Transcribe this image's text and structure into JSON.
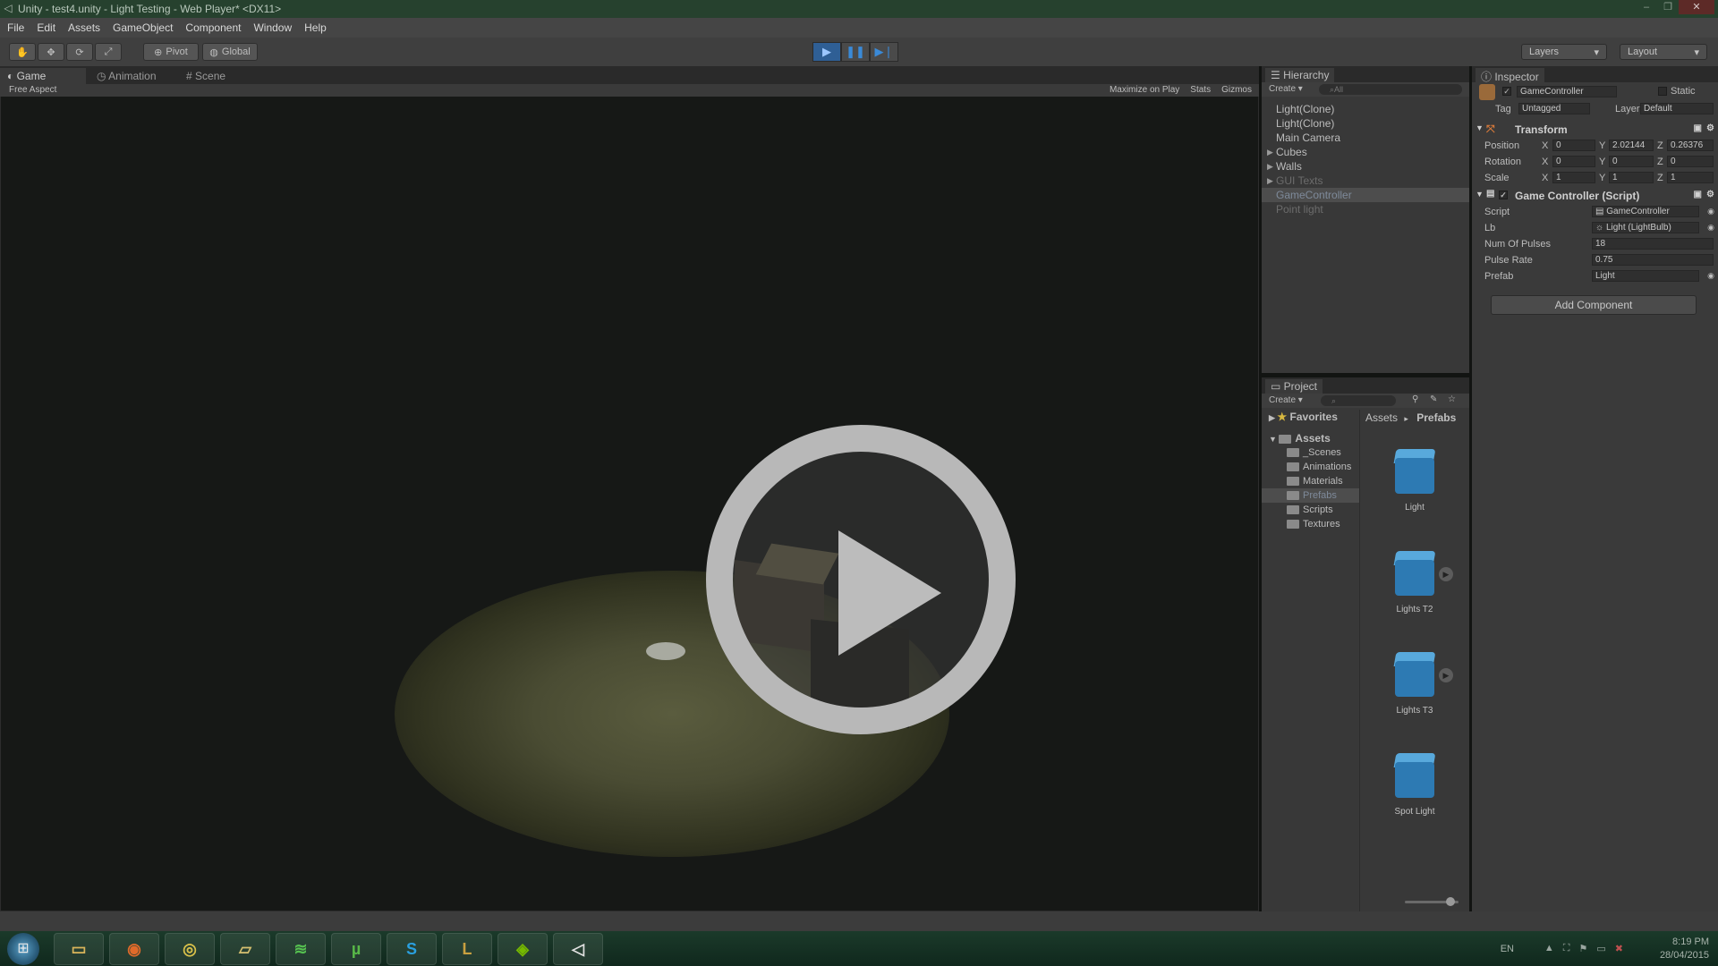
{
  "window": {
    "title": "Unity - test4.unity - Light Testing - Web Player* <DX11>",
    "controls": [
      "‒",
      "❐",
      "✕"
    ]
  },
  "menu": [
    "File",
    "Edit",
    "Assets",
    "GameObject",
    "Component",
    "Window",
    "Help"
  ],
  "toolbar": {
    "transform_tools": [
      "hand-icon",
      "move-icon",
      "rotate-icon",
      "scale-icon"
    ],
    "pivot_label": "Pivot",
    "global_label": "Global",
    "play_state": "playing",
    "layers_label": "Layers",
    "layout_label": "Layout"
  },
  "game_panel": {
    "tabs": [
      {
        "label": "Game",
        "active": true
      },
      {
        "label": "Animation",
        "active": false
      },
      {
        "label": "Scene",
        "active": false
      }
    ],
    "aspect": "Free Aspect",
    "options": [
      "Maximize on Play",
      "Stats",
      "Gizmos"
    ]
  },
  "hierarchy": {
    "title": "Hierarchy",
    "create_label": "Create",
    "search_placeholder": "All",
    "items": [
      {
        "label": "Light(Clone)",
        "expandable": false,
        "state": "normal"
      },
      {
        "label": "Light(Clone)",
        "expandable": false,
        "state": "normal"
      },
      {
        "label": "Main Camera",
        "expandable": false,
        "state": "normal"
      },
      {
        "label": "Cubes",
        "expandable": true,
        "state": "normal"
      },
      {
        "label": "Walls",
        "expandable": true,
        "state": "normal"
      },
      {
        "label": "GUI Texts",
        "expandable": true,
        "state": "dim"
      },
      {
        "label": "GameController",
        "expandable": false,
        "state": "selected"
      },
      {
        "label": "Point light",
        "expandable": false,
        "state": "dim"
      }
    ]
  },
  "project": {
    "title": "Project",
    "create_label": "Create",
    "favorites_label": "Favorites",
    "assets_label": "Assets",
    "folders": [
      {
        "label": "_Scenes",
        "selected": false
      },
      {
        "label": "Animations",
        "selected": false
      },
      {
        "label": "Materials",
        "selected": false
      },
      {
        "label": "Prefabs",
        "selected": true
      },
      {
        "label": "Scripts",
        "selected": false
      },
      {
        "label": "Textures",
        "selected": false
      }
    ],
    "breadcrumb": [
      "Assets",
      "Prefabs"
    ],
    "items": [
      {
        "label": "Light",
        "has_children": false
      },
      {
        "label": "Lights T2",
        "has_children": true
      },
      {
        "label": "Lights T3",
        "has_children": true
      },
      {
        "label": "Spot Light",
        "has_children": false
      }
    ]
  },
  "inspector": {
    "title": "Inspector",
    "object_name": "GameController",
    "static_label": "Static",
    "tag_label": "Tag",
    "tag_value": "Untagged",
    "layer_label": "Layer",
    "layer_value": "Default",
    "transform": {
      "title": "Transform",
      "rows": [
        {
          "label": "Position",
          "x": "0",
          "y": "2.02144",
          "z": "0.26376"
        },
        {
          "label": "Rotation",
          "x": "0",
          "y": "0",
          "z": "0"
        },
        {
          "label": "Scale",
          "x": "1",
          "y": "1",
          "z": "1"
        }
      ]
    },
    "script_component": {
      "title": "Game Controller (Script)",
      "fields": [
        {
          "label": "Script",
          "value": "GameController",
          "has_picker": true
        },
        {
          "label": "Lb",
          "value": "Light (LightBulb)",
          "has_picker": true
        },
        {
          "label": "Num Of Pulses",
          "value": "18",
          "has_picker": false
        },
        {
          "label": "Pulse Rate",
          "value": "0.75",
          "has_picker": false
        },
        {
          "label": "Prefab",
          "value": "Light",
          "has_picker": true
        }
      ]
    },
    "add_component_label": "Add Component"
  },
  "taskbar": {
    "apps": [
      {
        "name": "file-explorer-icon",
        "glyph": "▭",
        "color": "#d9b45a"
      },
      {
        "name": "firefox-icon",
        "glyph": "◉",
        "color": "#e06a2a"
      },
      {
        "name": "chrome-icon",
        "glyph": "◎",
        "color": "#d8c04a"
      },
      {
        "name": "folder-icon",
        "glyph": "▱",
        "color": "#d6c070"
      },
      {
        "name": "spotify-icon",
        "glyph": "≋",
        "color": "#55c050"
      },
      {
        "name": "utorrent-icon",
        "glyph": "µ",
        "color": "#58b848"
      },
      {
        "name": "skype-icon",
        "glyph": "S",
        "color": "#2aa0e0"
      },
      {
        "name": "league-icon",
        "glyph": "L",
        "color": "#c8a040"
      },
      {
        "name": "nvidia-icon",
        "glyph": "◈",
        "color": "#76b900"
      },
      {
        "name": "unity-icon",
        "glyph": "◁",
        "color": "#e0e0e0"
      }
    ],
    "language": "EN",
    "time": "8:19 PM",
    "date": "28/04/2015"
  }
}
